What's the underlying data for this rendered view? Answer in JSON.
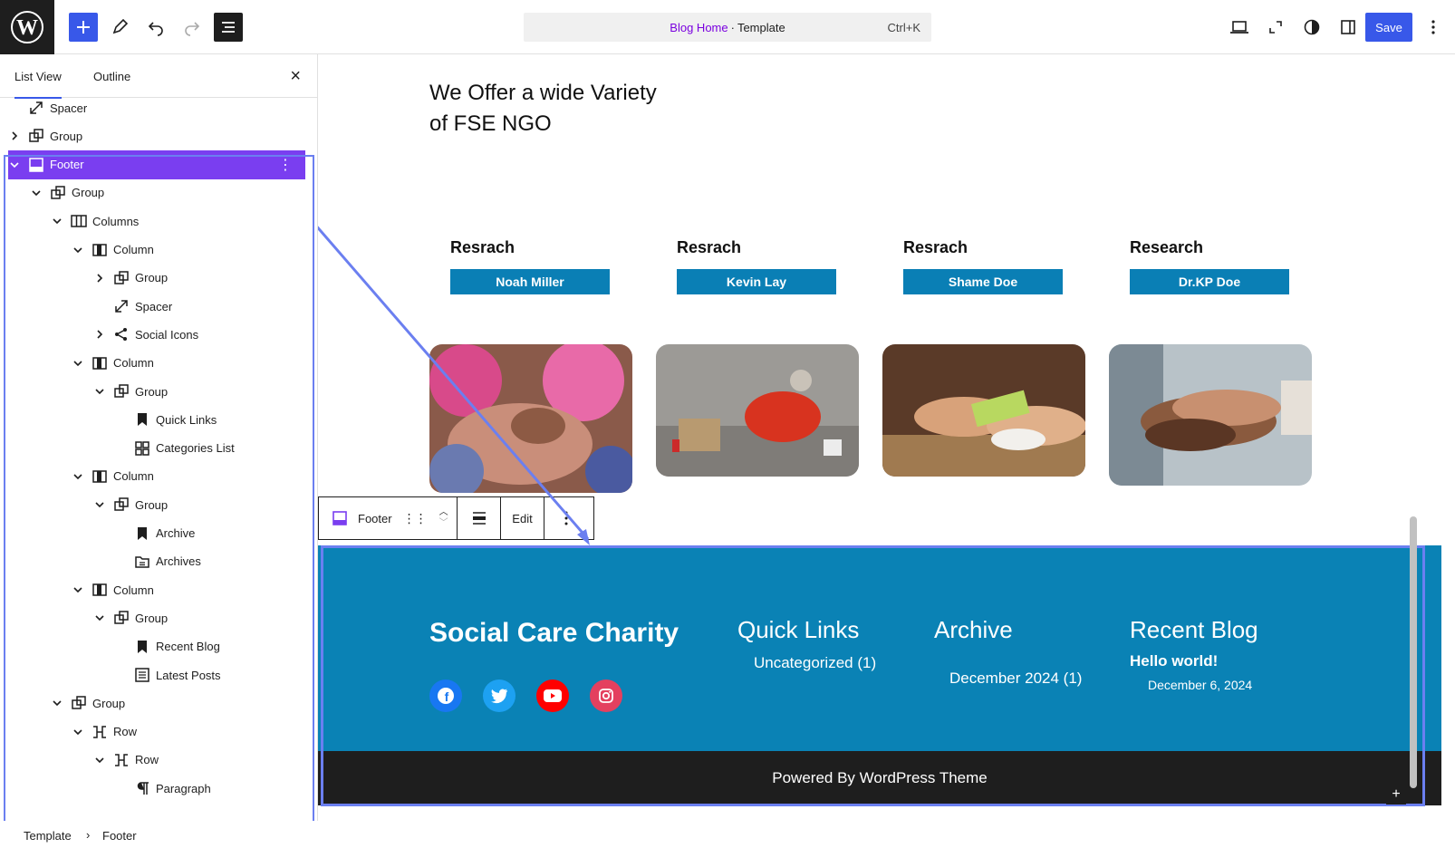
{
  "header": {
    "template_name": "Blog Home",
    "template_type": "Template",
    "separator": "·",
    "shortcut": "Ctrl+K",
    "save_label": "Save"
  },
  "panel": {
    "tabs": [
      "List View",
      "Outline"
    ],
    "active_tab": "List View",
    "tree": [
      {
        "label": "Spacer",
        "icon": "spacer-icon",
        "depth": 0,
        "chevron": "none"
      },
      {
        "label": "Group",
        "icon": "group-icon",
        "depth": 0,
        "chevron": "right"
      },
      {
        "label": "Footer",
        "icon": "footer-icon",
        "depth": 0,
        "chevron": "down",
        "selected": true
      },
      {
        "label": "Group",
        "icon": "group-icon",
        "depth": 1,
        "chevron": "down"
      },
      {
        "label": "Columns",
        "icon": "columns-icon",
        "depth": 2,
        "chevron": "down"
      },
      {
        "label": "Column",
        "icon": "column-icon",
        "depth": 3,
        "chevron": "down"
      },
      {
        "label": "Group",
        "icon": "group-icon",
        "depth": 4,
        "chevron": "right"
      },
      {
        "label": "Spacer",
        "icon": "spacer-icon",
        "depth": 4,
        "chevron": "none"
      },
      {
        "label": "Social Icons",
        "icon": "share-icon",
        "depth": 4,
        "chevron": "right"
      },
      {
        "label": "Column",
        "icon": "column-icon",
        "depth": 3,
        "chevron": "down"
      },
      {
        "label": "Group",
        "icon": "group-icon",
        "depth": 4,
        "chevron": "down"
      },
      {
        "label": "Quick Links",
        "icon": "bookmark-icon",
        "depth": 5,
        "chevron": "none"
      },
      {
        "label": "Categories List",
        "icon": "categories-icon",
        "depth": 5,
        "chevron": "none"
      },
      {
        "label": "Column",
        "icon": "column-icon",
        "depth": 3,
        "chevron": "down"
      },
      {
        "label": "Group",
        "icon": "group-icon",
        "depth": 4,
        "chevron": "down"
      },
      {
        "label": "Archive",
        "icon": "bookmark-icon",
        "depth": 5,
        "chevron": "none"
      },
      {
        "label": "Archives",
        "icon": "archive-icon",
        "depth": 5,
        "chevron": "none"
      },
      {
        "label": "Column",
        "icon": "column-icon",
        "depth": 3,
        "chevron": "down"
      },
      {
        "label": "Group",
        "icon": "group-icon",
        "depth": 4,
        "chevron": "down"
      },
      {
        "label": "Recent Blog",
        "icon": "bookmark-icon",
        "depth": 5,
        "chevron": "none"
      },
      {
        "label": "Latest Posts",
        "icon": "posts-list-icon",
        "depth": 5,
        "chevron": "none"
      },
      {
        "label": "Group",
        "icon": "group-icon",
        "depth": 2,
        "chevron": "down"
      },
      {
        "label": "Row",
        "icon": "row-icon",
        "depth": 3,
        "chevron": "down"
      },
      {
        "label": "Row",
        "icon": "row-icon",
        "depth": 4,
        "chevron": "down"
      },
      {
        "label": "Paragraph",
        "icon": "paragraph-icon",
        "depth": 5,
        "chevron": "none"
      }
    ],
    "breadcrumb": [
      "Template",
      "Footer"
    ]
  },
  "canvas": {
    "heading_line1": "We Offer a wide Variety",
    "heading_line2": "of FSE NGO",
    "cards": [
      {
        "title": "Resrach",
        "button": "Noah Miller"
      },
      {
        "title": "Resrach",
        "button": "Kevin Lay"
      },
      {
        "title": "Resrach",
        "button": "Shame Doe"
      },
      {
        "title": "Research",
        "button": "Dr.KP Doe"
      }
    ],
    "block_toolbar": {
      "block_name": "Footer",
      "edit_label": "Edit"
    },
    "footer": {
      "brand": "Social Care Charity",
      "quick_links_title": "Quick Links",
      "quick_link_item": "Uncategorized (1)",
      "archive_title": "Archive",
      "archive_item": "December 2024 (1)",
      "recent_blog_title": "Recent Blog",
      "recent_post_title": "Hello world!",
      "recent_post_date": "December 6, 2024",
      "social": [
        "facebook-icon",
        "twitter-icon",
        "youtube-icon",
        "instagram-icon"
      ],
      "powered_by": "Powered By WordPress Theme"
    }
  },
  "colors": {
    "accent": "#3858e9",
    "selected": "#7a3ef0",
    "footer_bg": "#0a82b5",
    "button_bg": "#0a7fb5",
    "dark": "#1e1e1e",
    "template_link": "#7a00df"
  }
}
